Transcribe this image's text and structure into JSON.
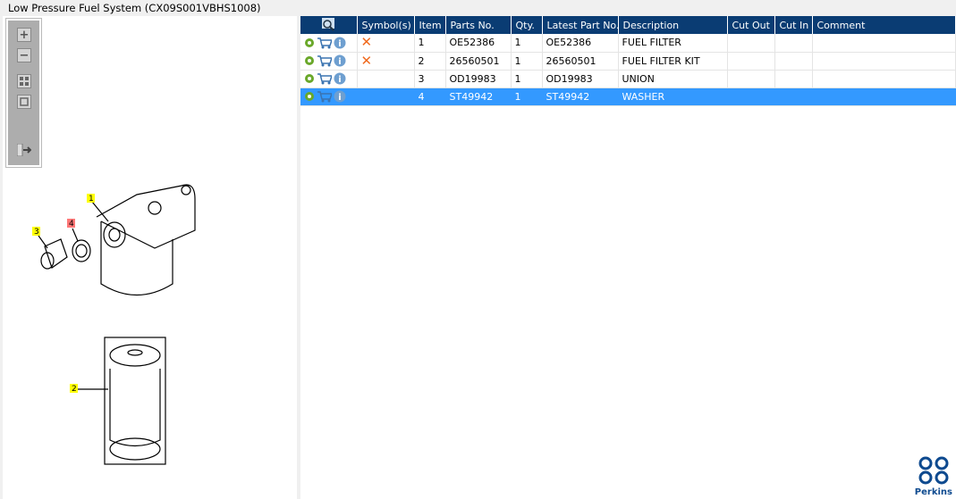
{
  "title": "Low Pressure Fuel System (CX09S001VBHS1008)",
  "toolbar": {
    "zoom_in": "+",
    "zoom_out": "−"
  },
  "drawing": {
    "callouts": [
      "1",
      "2",
      "3",
      "4"
    ],
    "highlighted_callout": "4"
  },
  "table": {
    "headers": [
      "Symbol(s)",
      "Item",
      "Parts No.",
      "Qty.",
      "Latest Part No.",
      "Description",
      "Cut Out",
      "Cut In",
      "Comment"
    ],
    "rows": [
      {
        "symbol": "✕",
        "item": "1",
        "part": "OE52386",
        "qty": "1",
        "latest": "OE52386",
        "desc": "FUEL FILTER",
        "cutout": "",
        "cutin": "",
        "comment": ""
      },
      {
        "symbol": "✕",
        "item": "2",
        "part": "26560501",
        "qty": "1",
        "latest": "26560501",
        "desc": "FUEL FILTER KIT",
        "cutout": "",
        "cutin": "",
        "comment": ""
      },
      {
        "symbol": "",
        "item": "3",
        "part": "OD19983",
        "qty": "1",
        "latest": "OD19983",
        "desc": "UNION",
        "cutout": "",
        "cutin": "",
        "comment": ""
      },
      {
        "symbol": "",
        "item": "4",
        "part": "ST49942",
        "qty": "1",
        "latest": "ST49942",
        "desc": "WASHER",
        "cutout": "",
        "cutin": "",
        "comment": "",
        "selected": true
      }
    ]
  },
  "logo": {
    "text": "Perkins"
  },
  "colors": {
    "header": "#0a3c73",
    "selected": "#3399ff",
    "symbol": "#f06a1e"
  }
}
